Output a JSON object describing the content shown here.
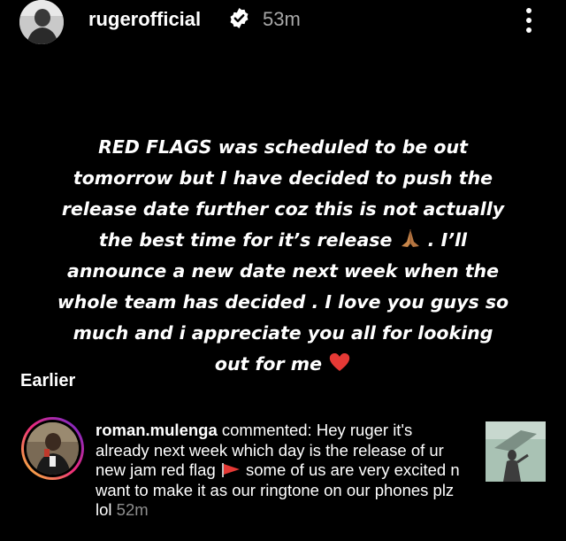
{
  "header": {
    "username": "rugerofficial",
    "time": "53m",
    "verified_icon": "verified-badge-icon",
    "more_icon": "more-options-icon"
  },
  "post": {
    "lines": [
      "RED FLAGS was scheduled to be out",
      "tomorrow but I have decided to push the",
      "release date further coz this is not actually",
      "the best time for it’s release",
      ". I’ll",
      "announce a new date next week when the",
      "whole team has decided . I love you guys so",
      "much and i appreciate you all for looking",
      "out for me"
    ],
    "emojis": [
      "folded-hands-emoji",
      "red-heart-emoji"
    ]
  },
  "section": {
    "earlier_label": "Earlier"
  },
  "comment": {
    "username": "roman.mulenga",
    "action": " commented: ",
    "text_part1": "Hey ruger it's already next week which day is the release of ur new jam red flag ",
    "text_part2": " some of us are very excited n want to make it as our ringtone on our phones plz lol ",
    "time": "52m",
    "flag_emoji": "red-triangular-flag-emoji"
  },
  "colors": {
    "background": "#000000",
    "text": "#ffffff",
    "secondary_text": "#a8a8a8",
    "verified_blue": "#ffffff",
    "story_ring_gradient": [
      "#f9ce34",
      "#ee2a7b",
      "#6228d7"
    ]
  }
}
